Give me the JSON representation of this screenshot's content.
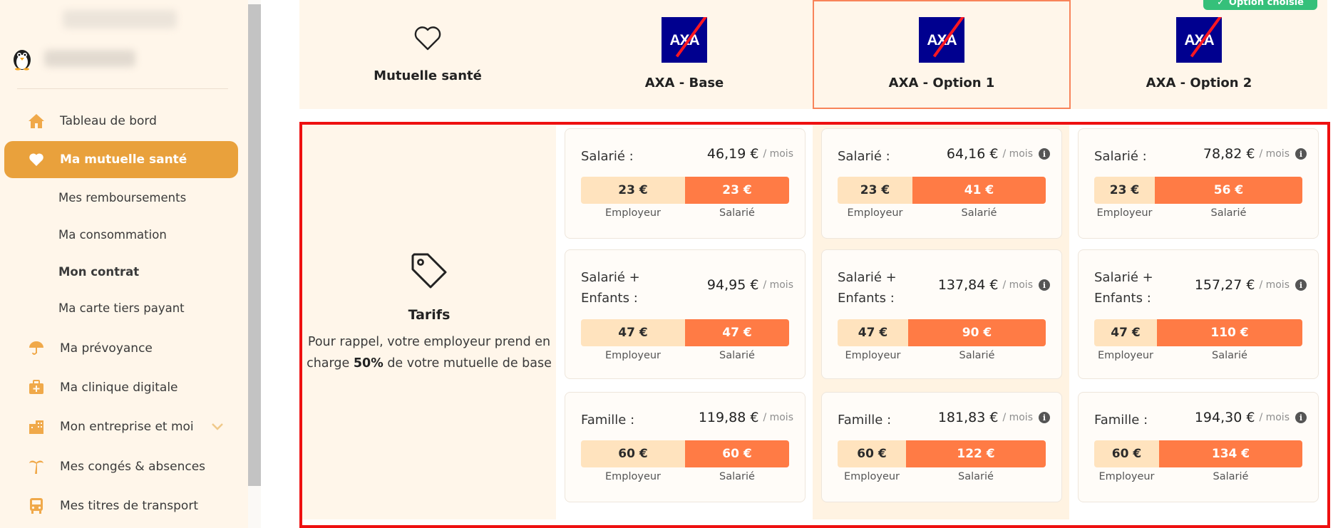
{
  "sidebar": {
    "menu": [
      {
        "label": "Tableau de bord",
        "icon": "home-icon"
      },
      {
        "label": "Ma mutuelle santé",
        "icon": "heart-icon",
        "active": true
      },
      {
        "label": "Ma prévoyance",
        "icon": "umbrella-icon"
      },
      {
        "label": "Ma clinique digitale",
        "icon": "medical-kit-icon"
      },
      {
        "label": "Mon entreprise et moi",
        "icon": "building-icon"
      },
      {
        "label": "Mes congés & absences",
        "icon": "palm-tree-icon"
      },
      {
        "label": "Mes titres de transport",
        "icon": "bus-icon"
      }
    ],
    "submenu": [
      {
        "label": "Mes remboursements"
      },
      {
        "label": "Ma consommation"
      },
      {
        "label": "Mon contrat",
        "bold": true
      },
      {
        "label": "Ma carte tiers payant"
      }
    ],
    "accent_color": "#e9a13c"
  },
  "header": {
    "mutuelle_label": "Mutuelle santé",
    "chosen_badge": "Option choisie",
    "plans": [
      {
        "name": "AXA - Base",
        "logo_text": "AXA"
      },
      {
        "name": "AXA - Option 1",
        "logo_text": "AXA",
        "chosen": true
      },
      {
        "name": "AXA - Option 2",
        "logo_text": "AXA"
      }
    ]
  },
  "tarifs": {
    "title": "Tarifs",
    "desc_before": "Pour rappel, votre employeur prend en charge",
    "desc_bold": "50%",
    "desc_after": "de votre mutuelle de base",
    "per_month": "/ mois",
    "employer_label": "Employeur",
    "employee_label": "Salarié",
    "info_icon": "info-icon",
    "rows": [
      "Salarié :",
      "Salarié + Enfants :",
      "Famille :"
    ],
    "plans": [
      {
        "cards": [
          {
            "label": "Salarié :",
            "price": "46,19 €",
            "employer": "23 €",
            "employee": "23 €",
            "employer_share": 0.5
          },
          {
            "label": "Salarié + Enfants :",
            "price": "94,95 €",
            "employer": "47 €",
            "employee": "47 €",
            "employer_share": 0.5
          },
          {
            "label": "Famille :",
            "price": "119,88 €",
            "employer": "60 €",
            "employee": "60 €",
            "employer_share": 0.5
          }
        ]
      },
      {
        "cards": [
          {
            "label": "Salarié :",
            "price": "64,16 €",
            "employer": "23 €",
            "employee": "41 €",
            "employer_share": 0.36,
            "info": true
          },
          {
            "label": "Salarié + Enfants :",
            "price": "137,84 €",
            "employer": "47 €",
            "employee": "90 €",
            "employer_share": 0.34,
            "info": true
          },
          {
            "label": "Famille :",
            "price": "181,83 €",
            "employer": "60 €",
            "employee": "122 €",
            "employer_share": 0.33,
            "info": true
          }
        ]
      },
      {
        "cards": [
          {
            "label": "Salarié :",
            "price": "78,82 €",
            "employer": "23 €",
            "employee": "56 €",
            "employer_share": 0.29,
            "info": true
          },
          {
            "label": "Salarié + Enfants :",
            "price": "157,27 €",
            "employer": "47 €",
            "employee": "110 €",
            "employer_share": 0.3,
            "info": true
          },
          {
            "label": "Famille :",
            "price": "194,30 €",
            "employer": "60 €",
            "employee": "134 €",
            "employer_share": 0.31,
            "info": true
          }
        ]
      }
    ]
  }
}
